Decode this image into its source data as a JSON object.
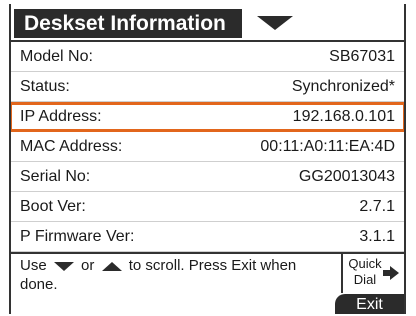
{
  "header": {
    "title": "Deskset Information",
    "dropdown_icon": "triangle-down-icon"
  },
  "rows": [
    {
      "label": "Model No:",
      "value": "SB67031"
    },
    {
      "label": "Status:",
      "value": "Synchronized*"
    },
    {
      "label": "IP Address:",
      "value": "192.168.0.101",
      "selected": true
    },
    {
      "label": "MAC Address:",
      "value": "00:11:A0:11:EA:4D"
    },
    {
      "label": "Serial No:",
      "value": "GG20013043"
    },
    {
      "label": "Boot Ver:",
      "value": "2.7.1"
    },
    {
      "label": "P Firmware Ver:",
      "value": "3.1.1"
    }
  ],
  "help": {
    "part1": "Use",
    "part2": "or",
    "part3": "to scroll. Press Exit when done."
  },
  "softkeys": {
    "quick_dial": "Quick Dial",
    "exit": "Exit"
  },
  "colors": {
    "selection": "#e2661c",
    "header_bg": "#2b2b2b"
  }
}
